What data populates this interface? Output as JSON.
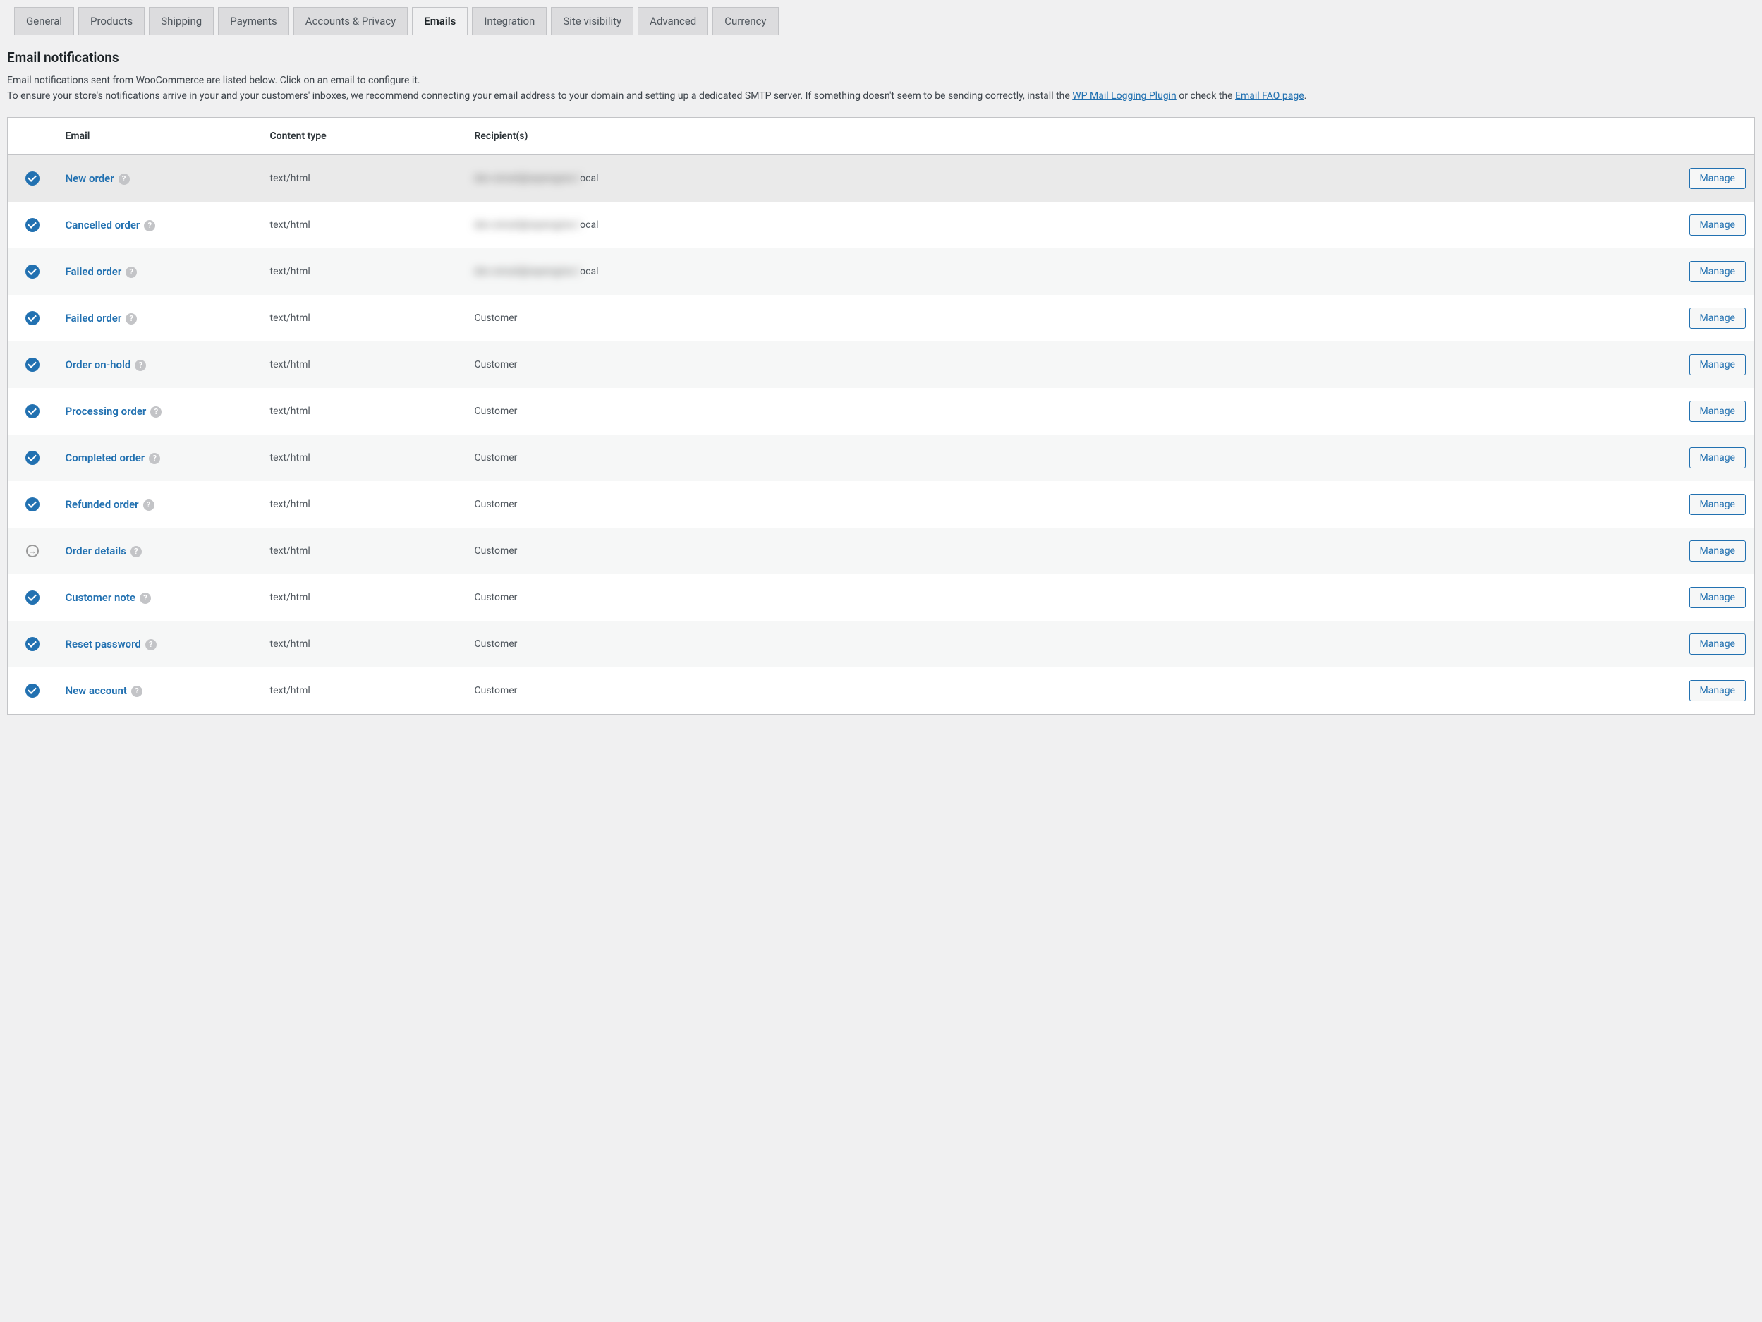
{
  "tabs": [
    {
      "label": "General"
    },
    {
      "label": "Products"
    },
    {
      "label": "Shipping"
    },
    {
      "label": "Payments"
    },
    {
      "label": "Accounts & Privacy"
    },
    {
      "label": "Emails",
      "active": true
    },
    {
      "label": "Integration"
    },
    {
      "label": "Site visibility"
    },
    {
      "label": "Advanced"
    },
    {
      "label": "Currency"
    }
  ],
  "page": {
    "title": "Email notifications",
    "desc_line1": "Email notifications sent from WooCommerce are listed below. Click on an email to configure it.",
    "desc_line2_a": "To ensure your store's notifications arrive in your and your customers' inboxes, we recommend connecting your email address to your domain and setting up a dedicated SMTP server. If something doesn't seem to be sending correctly, install the ",
    "desc_link1": "WP Mail Logging Plugin",
    "desc_line2_b": " or check the ",
    "desc_link2": "Email FAQ page",
    "desc_line2_c": "."
  },
  "table": {
    "headers": {
      "email": "Email",
      "content_type": "Content type",
      "recipients": "Recipient(s)"
    },
    "manage_label": "Manage",
    "rows": [
      {
        "status": "enabled",
        "name": "New order",
        "content_type": "text/html",
        "recipient_blurred": "dev-email@wpengine.l",
        "recipient_suffix": "ocal"
      },
      {
        "status": "enabled",
        "name": "Cancelled order",
        "content_type": "text/html",
        "recipient_blurred": "dev-email@wpengine.l",
        "recipient_suffix": "ocal"
      },
      {
        "status": "enabled",
        "name": "Failed order",
        "content_type": "text/html",
        "recipient_blurred": "dev-email@wpengine.l",
        "recipient_suffix": "ocal"
      },
      {
        "status": "enabled",
        "name": "Failed order",
        "content_type": "text/html",
        "recipient": "Customer"
      },
      {
        "status": "enabled",
        "name": "Order on-hold",
        "content_type": "text/html",
        "recipient": "Customer"
      },
      {
        "status": "enabled",
        "name": "Processing order",
        "content_type": "text/html",
        "recipient": "Customer"
      },
      {
        "status": "enabled",
        "name": "Completed order",
        "content_type": "text/html",
        "recipient": "Customer"
      },
      {
        "status": "enabled",
        "name": "Refunded order",
        "content_type": "text/html",
        "recipient": "Customer"
      },
      {
        "status": "manual",
        "name": "Order details",
        "content_type": "text/html",
        "recipient": "Customer"
      },
      {
        "status": "enabled",
        "name": "Customer note",
        "content_type": "text/html",
        "recipient": "Customer"
      },
      {
        "status": "enabled",
        "name": "Reset password",
        "content_type": "text/html",
        "recipient": "Customer"
      },
      {
        "status": "enabled",
        "name": "New account",
        "content_type": "text/html",
        "recipient": "Customer"
      }
    ]
  }
}
